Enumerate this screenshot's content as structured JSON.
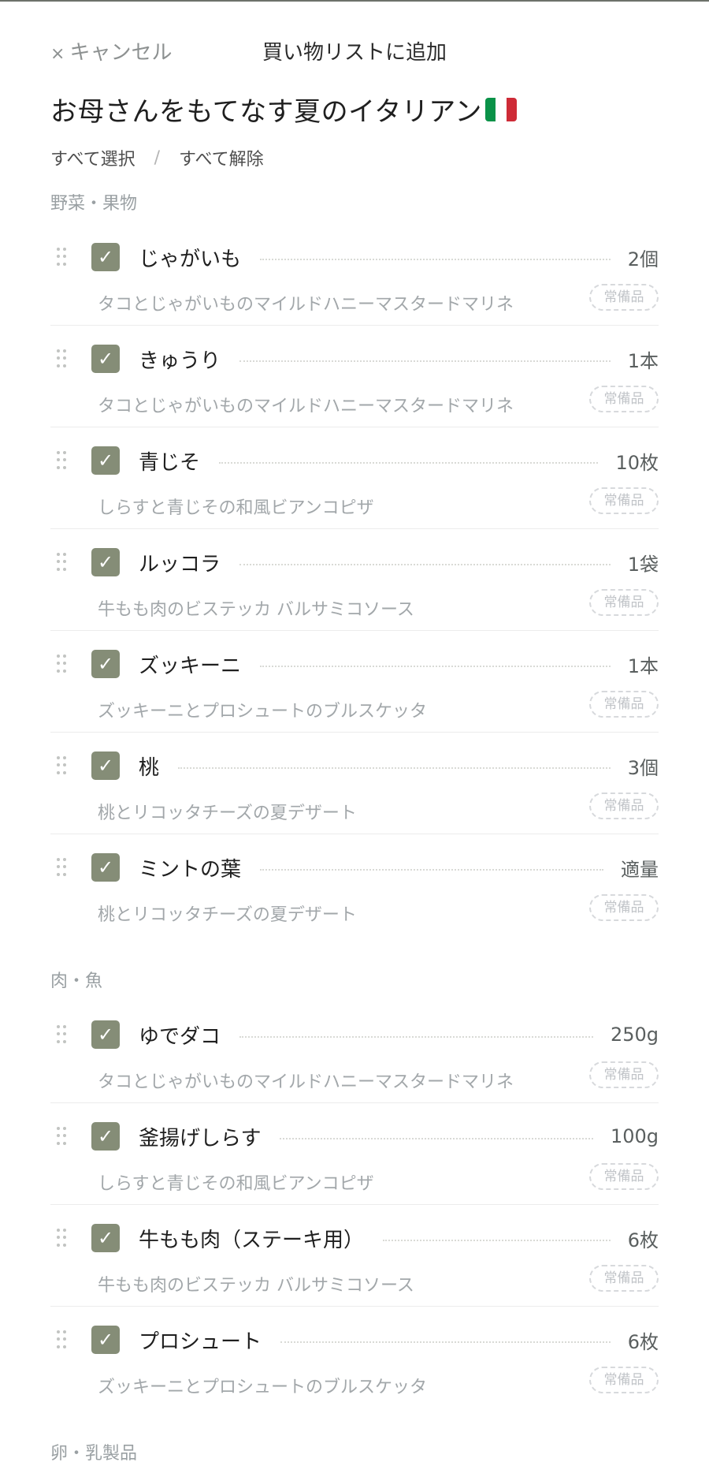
{
  "header": {
    "cancel_icon": "×",
    "cancel_label": "キャンセル",
    "title": "買い物リストに追加"
  },
  "recipe": {
    "title": "お母さんをもてなす夏のイタリアン",
    "flag_colors": [
      "#0a9248",
      "#ffffff",
      "#ce2b37"
    ]
  },
  "selection": {
    "select_all": "すべて選択",
    "separator": "/",
    "deselect_all": "すべて解除"
  },
  "colors": {
    "checkbox": "#858d77"
  },
  "icons": {
    "checkbox_mark": "✓",
    "drag_handle": "drag-handle-icon"
  },
  "categories": [
    {
      "name": "野菜・果物",
      "items": [
        {
          "name": "じゃがいも",
          "qty": "2個",
          "recipe": "タコとじゃがいものマイルドハニーマスタードマリネ",
          "badge": "常備品",
          "checked": true
        },
        {
          "name": "きゅうり",
          "qty": "1本",
          "recipe": "タコとじゃがいものマイルドハニーマスタードマリネ",
          "badge": "常備品",
          "checked": true
        },
        {
          "name": "青じそ",
          "qty": "10枚",
          "recipe": "しらすと青じその和風ビアンコピザ",
          "badge": "常備品",
          "checked": true
        },
        {
          "name": "ルッコラ",
          "qty": "1袋",
          "recipe": "牛もも肉のビステッカ バルサミコソース",
          "badge": "常備品",
          "checked": true
        },
        {
          "name": "ズッキーニ",
          "qty": "1本",
          "recipe": "ズッキーニとプロシュートのブルスケッタ",
          "badge": "常備品",
          "checked": true
        },
        {
          "name": "桃",
          "qty": "3個",
          "recipe": "桃とリコッタチーズの夏デザート",
          "badge": "常備品",
          "checked": true
        },
        {
          "name": "ミントの葉",
          "qty": "適量",
          "recipe": "桃とリコッタチーズの夏デザート",
          "badge": "常備品",
          "checked": true
        }
      ]
    },
    {
      "name": "肉・魚",
      "items": [
        {
          "name": "ゆでダコ",
          "qty": "250g",
          "recipe": "タコとじゃがいものマイルドハニーマスタードマリネ",
          "badge": "常備品",
          "checked": true
        },
        {
          "name": "釜揚げしらす",
          "qty": "100g",
          "recipe": "しらすと青じその和風ビアンコピザ",
          "badge": "常備品",
          "checked": true
        },
        {
          "name": "牛もも肉（ステーキ用）",
          "qty": "6枚",
          "recipe": "牛もも肉のビステッカ バルサミコソース",
          "badge": "常備品",
          "checked": true
        },
        {
          "name": "プロシュート",
          "qty": "6枚",
          "recipe": "ズッキーニとプロシュートのブルスケッタ",
          "badge": "常備品",
          "checked": true
        }
      ]
    },
    {
      "name": "卵・乳製品",
      "items": []
    }
  ]
}
